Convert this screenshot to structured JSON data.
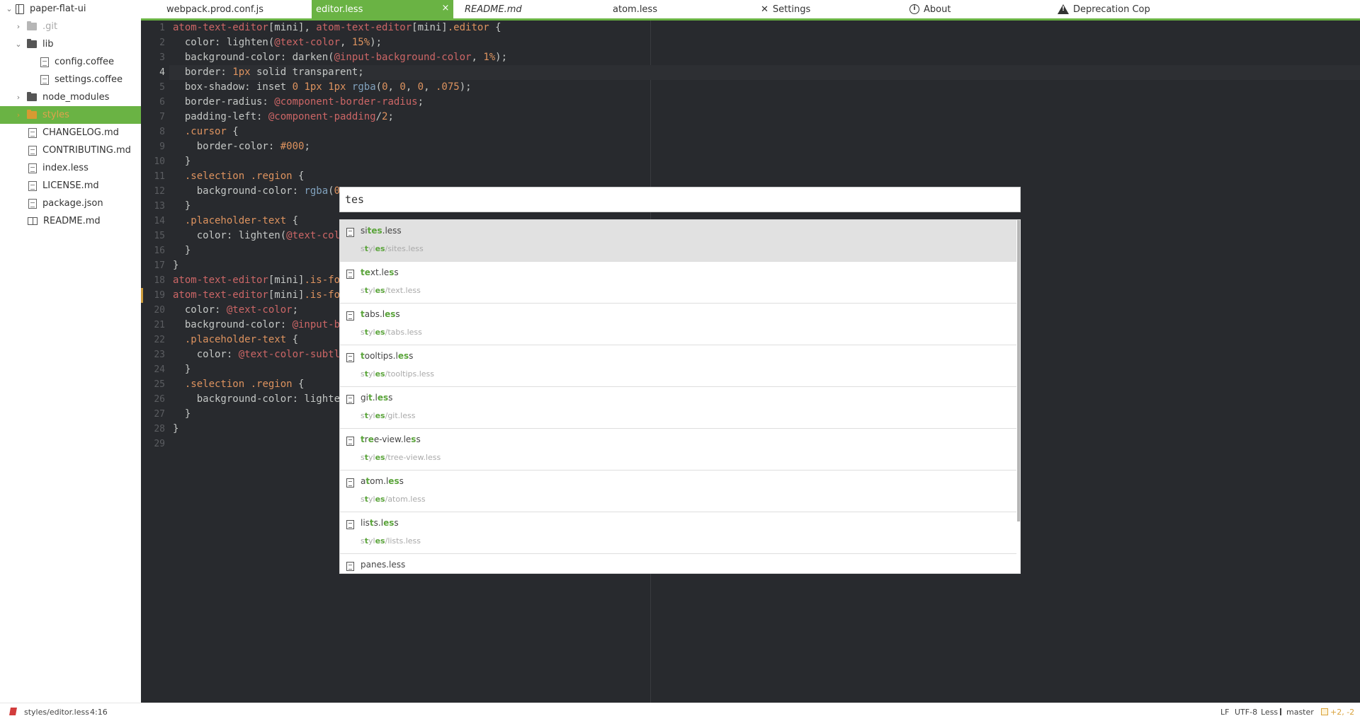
{
  "tree": {
    "root": "paper-flat-ui",
    "items": [
      {
        "label": ".git",
        "kind": "folder",
        "expanded": false,
        "dim": true
      },
      {
        "label": "lib",
        "kind": "folder",
        "expanded": true
      },
      {
        "label": "config.coffee",
        "kind": "file"
      },
      {
        "label": "settings.coffee",
        "kind": "file"
      },
      {
        "label": "node_modules",
        "kind": "folder",
        "expanded": false
      },
      {
        "label": "styles",
        "kind": "folder",
        "expanded": false,
        "selected": true
      },
      {
        "label": "CHANGELOG.md",
        "kind": "file"
      },
      {
        "label": "CONTRIBUTING.md",
        "kind": "file"
      },
      {
        "label": "index.less",
        "kind": "file"
      },
      {
        "label": "LICENSE.md",
        "kind": "file"
      },
      {
        "label": "package.json",
        "kind": "file"
      },
      {
        "label": "README.md",
        "kind": "book"
      }
    ]
  },
  "tabs": [
    {
      "label": "webpack.prod.conf.js"
    },
    {
      "label": "editor.less",
      "active": true,
      "close": "×"
    },
    {
      "label": "README.md",
      "italic": true
    },
    {
      "label": "atom.less"
    },
    {
      "label": "Settings",
      "icon": "tools-icon"
    },
    {
      "label": "About",
      "icon": "info-icon"
    },
    {
      "label": "Deprecation Cop",
      "icon": "warning-icon"
    }
  ],
  "editor": {
    "cursor_line": 4,
    "modified_lines": [
      19
    ],
    "lines": [
      "atom-text-editor[mini], atom-text-editor[mini].editor {",
      "  color: lighten(@text-color, 15%);",
      "  background-color: darken(@input-background-color, 1%);",
      "  border: 1px solid transparent;",
      "  box-shadow: inset 0 1px 1px rgba(0, 0, 0, .075);",
      "  border-radius: @component-border-radius;",
      "  padding-left: @component-padding/2;",
      "  .cursor {",
      "    border-color: #000;",
      "  }",
      "  .selection .region {",
      "    background-color: rgba(0",
      "  }",
      "  .placeholder-text {",
      "    color: lighten(@text-col",
      "  }",
      "}",
      "atom-text-editor[mini].is-fo",
      "atom-text-editor[mini].is-fo",
      "  color: @text-color;",
      "  background-color: @input-b",
      "  .placeholder-text {",
      "    color: @text-color-subtl",
      "  }",
      "  .selection .region {",
      "    background-color: lighte",
      "  }",
      "}",
      ""
    ]
  },
  "finder": {
    "query": "tes",
    "items": [
      {
        "name": "sites.less",
        "path": "styles/sites.less",
        "selected": true
      },
      {
        "name": "text.less",
        "path": "styles/text.less"
      },
      {
        "name": "tabs.less",
        "path": "styles/tabs.less"
      },
      {
        "name": "tooltips.less",
        "path": "styles/tooltips.less"
      },
      {
        "name": "git.less",
        "path": "styles/git.less"
      },
      {
        "name": "tree-view.less",
        "path": "styles/tree-view.less"
      },
      {
        "name": "atom.less",
        "path": "styles/atom.less"
      },
      {
        "name": "lists.less",
        "path": "styles/lists.less"
      },
      {
        "name": "panes.less",
        "path": ""
      }
    ]
  },
  "statusbar": {
    "file_path": "styles/editor.less",
    "cursor_position": "4:16",
    "line_ending": "LF",
    "encoding": "UTF-8",
    "grammar": "Less",
    "branch": "master",
    "diff": "+2, -2"
  },
  "colors": {
    "accent": "#6ab344",
    "editor_bg": "#282a2e",
    "match": "#5aa43a"
  }
}
